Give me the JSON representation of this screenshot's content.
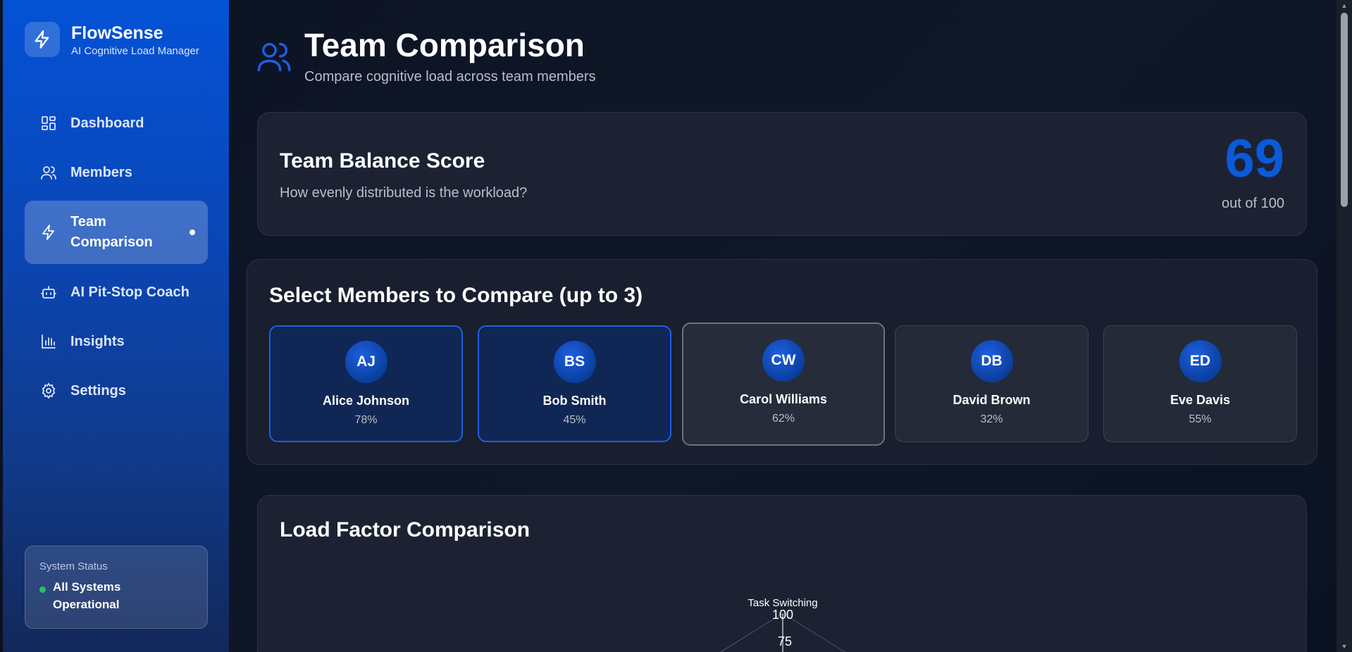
{
  "brand": {
    "name": "FlowSense",
    "subtitle": "AI Cognitive Load Manager",
    "icon": "lightning-icon"
  },
  "nav": [
    {
      "label": "Dashboard",
      "icon": "dashboard-icon"
    },
    {
      "label": "Members",
      "icon": "users-icon"
    },
    {
      "label": "Team Comparison",
      "icon": "lightning-icon",
      "active": true
    },
    {
      "label": "AI Pit-Stop Coach",
      "icon": "robot-icon"
    },
    {
      "label": "Insights",
      "icon": "bar-chart-icon"
    },
    {
      "label": "Settings",
      "icon": "gear-icon"
    }
  ],
  "system_status": {
    "label": "System Status",
    "text": "All Systems Operational",
    "color": "#22c55e"
  },
  "page": {
    "title": "Team Comparison",
    "subtitle": "Compare cognitive load across team members",
    "icon": "users-icon"
  },
  "balance": {
    "title": "Team Balance Score",
    "subtitle": "How evenly distributed is the workload?",
    "score": "69",
    "score_suffix": "out of 100"
  },
  "selection": {
    "title": "Select Members to Compare (up to 3)",
    "members": [
      {
        "initials": "AJ",
        "name": "Alice Johnson",
        "load": "78%",
        "selected": true
      },
      {
        "initials": "BS",
        "name": "Bob Smith",
        "load": "45%",
        "selected": true
      },
      {
        "initials": "CW",
        "name": "Carol Williams",
        "load": "62%",
        "selected": false
      },
      {
        "initials": "DB",
        "name": "David Brown",
        "load": "32%",
        "selected": false
      },
      {
        "initials": "ED",
        "name": "Eve Davis",
        "load": "55%",
        "selected": false
      }
    ]
  },
  "load_factor": {
    "title": "Load Factor Comparison",
    "axis_label": "Task Switching",
    "ticks": [
      "100",
      "75"
    ]
  },
  "colors": {
    "accent": "#0a5bd9",
    "sidebar": "#0352d6",
    "selected_border": "#1d5fe6"
  }
}
